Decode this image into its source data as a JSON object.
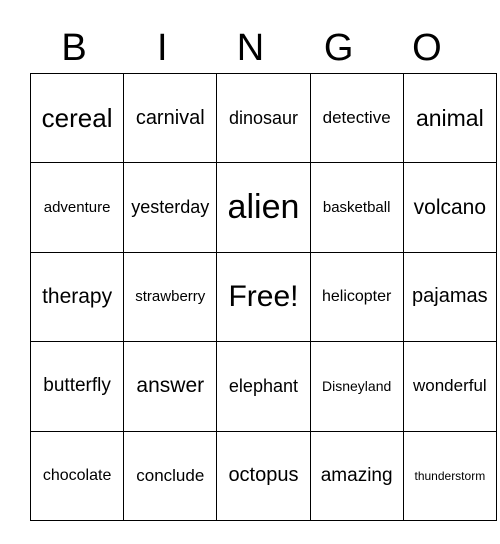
{
  "header": [
    "B",
    "I",
    "N",
    "G",
    "O"
  ],
  "cells": [
    [
      {
        "text": "cereal",
        "size": 26
      },
      {
        "text": "carnival",
        "size": 20
      },
      {
        "text": "dinosaur",
        "size": 18
      },
      {
        "text": "detective",
        "size": 17
      },
      {
        "text": "animal",
        "size": 23
      }
    ],
    [
      {
        "text": "adventure",
        "size": 15
      },
      {
        "text": "yesterday",
        "size": 18
      },
      {
        "text": "alien",
        "size": 34
      },
      {
        "text": "basketball",
        "size": 15
      },
      {
        "text": "volcano",
        "size": 21
      }
    ],
    [
      {
        "text": "therapy",
        "size": 21
      },
      {
        "text": "strawberry",
        "size": 15
      },
      {
        "text": "Free!",
        "size": 30
      },
      {
        "text": "helicopter",
        "size": 16
      },
      {
        "text": "pajamas",
        "size": 20
      }
    ],
    [
      {
        "text": "butterfly",
        "size": 19
      },
      {
        "text": "answer",
        "size": 21
      },
      {
        "text": "elephant",
        "size": 18
      },
      {
        "text": "Disneyland",
        "size": 14
      },
      {
        "text": "wonderful",
        "size": 17
      }
    ],
    [
      {
        "text": "chocolate",
        "size": 16
      },
      {
        "text": "conclude",
        "size": 17
      },
      {
        "text": "octopus",
        "size": 20
      },
      {
        "text": "amazing",
        "size": 19
      },
      {
        "text": "thunderstorm",
        "size": 12
      }
    ]
  ]
}
